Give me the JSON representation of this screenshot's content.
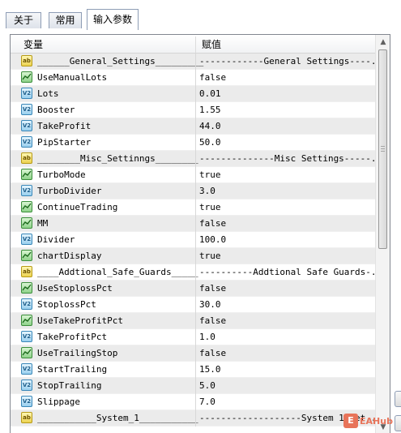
{
  "tabs": [
    {
      "label": "关于",
      "active": false
    },
    {
      "label": "常用",
      "active": false
    },
    {
      "label": "输入参数",
      "active": true
    }
  ],
  "table": {
    "columns": {
      "variable": "变量",
      "value": "赋值"
    },
    "rows": [
      {
        "type": "string",
        "name": "______General_Settings_________",
        "value": "------------General Settings----..."
      },
      {
        "type": "bool",
        "name": "UseManualLots",
        "value": "false"
      },
      {
        "type": "double",
        "name": "Lots",
        "value": "0.01"
      },
      {
        "type": "double",
        "name": "Booster",
        "value": "1.55"
      },
      {
        "type": "double",
        "name": "TakeProfit",
        "value": "44.0"
      },
      {
        "type": "double",
        "name": "PipStarter",
        "value": "50.0"
      },
      {
        "type": "string",
        "name": "________Misc_Settinngs________",
        "value": "--------------Misc Settings-----..."
      },
      {
        "type": "bool",
        "name": "TurboMode",
        "value": "true"
      },
      {
        "type": "double",
        "name": "TurboDivider",
        "value": "3.0"
      },
      {
        "type": "bool",
        "name": "ContinueTrading",
        "value": "true"
      },
      {
        "type": "bool",
        "name": "MM",
        "value": "false"
      },
      {
        "type": "double",
        "name": "Divider",
        "value": "100.0"
      },
      {
        "type": "bool",
        "name": "chartDisplay",
        "value": "true"
      },
      {
        "type": "string",
        "name": "____Addtional_Safe_Guards_____",
        "value": "----------Addtional Safe Guards-..."
      },
      {
        "type": "bool",
        "name": "UseStoplossPct",
        "value": "false"
      },
      {
        "type": "double",
        "name": "StoplossPct",
        "value": "30.0"
      },
      {
        "type": "bool",
        "name": "UseTakeProfitPct",
        "value": "false"
      },
      {
        "type": "double",
        "name": "TakeProfitPct",
        "value": "1.0"
      },
      {
        "type": "bool",
        "name": "UseTrailingStop",
        "value": "false"
      },
      {
        "type": "double",
        "name": "StartTrailing",
        "value": "15.0"
      },
      {
        "type": "double",
        "name": "StopTrailing",
        "value": "5.0"
      },
      {
        "type": "double",
        "name": "Slippage",
        "value": "7.0"
      },
      {
        "type": "string",
        "name": "___________System_1___________",
        "value": "-------------------System 1 Set..."
      }
    ]
  },
  "icons": {
    "string": "ab-icon",
    "bool": "boolean-icon",
    "double": "value-icon"
  },
  "icon_labels": {
    "string": "ab",
    "double": "V2"
  },
  "scrollbar": {
    "up_arrow": "▲",
    "down_arrow": "▼",
    "position_fraction": 0
  },
  "watermark": {
    "text": "EAHub"
  },
  "colors": {
    "alt_row": "#ebebeb",
    "grid_border": "#828790",
    "tab_border": "#8e9db5"
  }
}
